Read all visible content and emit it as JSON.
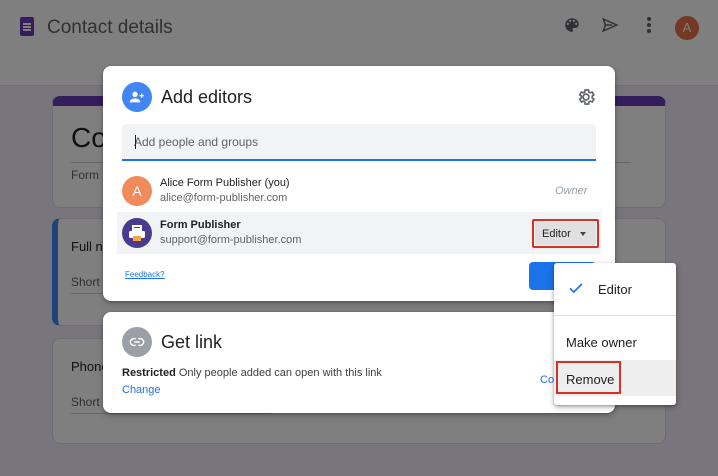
{
  "background": {
    "doc_title": "Contact details",
    "avatar_letter": "A",
    "form_title_partial": "Co",
    "form_description_partial": "Form",
    "q1_label_partial": "Full n",
    "q1_answer_partial": "Short",
    "q2_label_partial": "Phone",
    "q2_answer_partial": "Short"
  },
  "share_dialog": {
    "title": "Add editors",
    "search_placeholder": "Add people and groups",
    "people": [
      {
        "avatar_letter": "A",
        "name": "Alice Form Publisher (you)",
        "email": "alice@form-publisher.com",
        "role": "Owner"
      },
      {
        "name": "Form Publisher",
        "email": "support@form-publisher.com",
        "role": "Editor"
      }
    ],
    "feedback_label": "Feedback?",
    "done_label": "D"
  },
  "link_dialog": {
    "title": "Get link",
    "restricted_label": "Restricted",
    "restricted_desc": "Only people added can open with this link",
    "change_label": "Change",
    "copy_label_partial": "Co"
  },
  "role_menu": {
    "items": [
      {
        "label": "Editor",
        "checked": true
      },
      {
        "label": "Make owner"
      },
      {
        "label": "Remove"
      }
    ]
  },
  "colors": {
    "accent_blue": "#1a73e8",
    "highlight_red": "#d93025",
    "forms_purple": "#673ab7"
  },
  "icons": [
    "doc-icon",
    "palette-icon",
    "send-icon",
    "more-vert-icon",
    "add-person-icon",
    "gear-icon",
    "form-publisher-icon",
    "link-icon",
    "check-icon",
    "chevron-down-icon"
  ]
}
